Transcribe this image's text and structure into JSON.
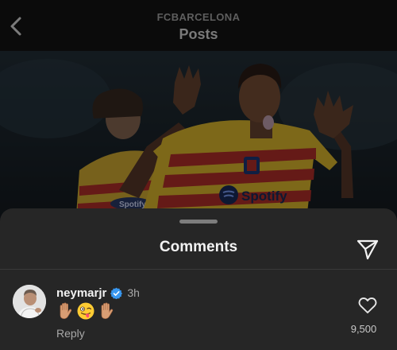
{
  "header": {
    "account_name": "FCBARCELONA",
    "title": "Posts",
    "back_icon": "chevron-left-icon"
  },
  "post": {
    "jersey_sponsor": "Spotify",
    "image_subject": "player celebrating"
  },
  "comments_sheet": {
    "title": "Comments",
    "share_icon": "paper-plane-icon",
    "comments": [
      {
        "username": "neymarjr",
        "verified": true,
        "time": "3h",
        "text": "✋😜✋",
        "reply_label": "Reply",
        "like_icon": "heart-outline-icon",
        "like_count": "9,500"
      }
    ]
  },
  "colors": {
    "sheet_bg": "#262626",
    "verified_blue": "#3897f0",
    "text_primary": "#f2f2f2",
    "text_secondary": "#a8a8a8"
  }
}
